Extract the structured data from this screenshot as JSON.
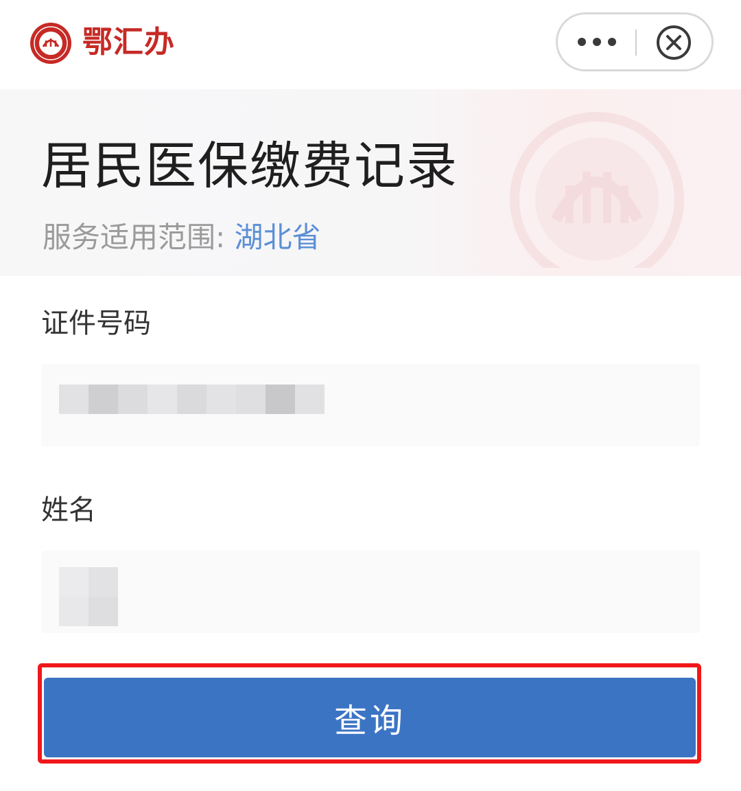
{
  "topbar": {
    "brand_name": "鄂汇办"
  },
  "header": {
    "title": "居民医保缴费记录",
    "scope_label": "服务适用范围:",
    "scope_value": "湖北省"
  },
  "form": {
    "id_label": "证件号码",
    "name_label": "姓名"
  },
  "actions": {
    "query_label": "查询"
  },
  "colors": {
    "brand": "#c62a25",
    "accent": "#3c74c4",
    "link": "#5b8fd6",
    "highlight": "#f0181a"
  },
  "icons": {
    "logo": "ehuiban-logo-icon",
    "more": "more-dots-icon",
    "close": "close-circle-icon"
  }
}
